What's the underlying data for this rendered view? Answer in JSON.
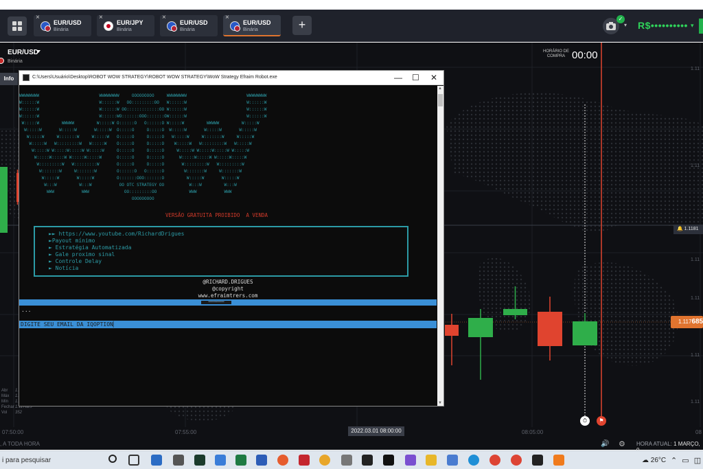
{
  "topbar": {
    "tabs": [
      {
        "pair": "EUR/USD",
        "kind": "Binária",
        "flag": "eu-us-flag-icon"
      },
      {
        "pair": "EUR/JPY",
        "kind": "Binária",
        "flag": "eu-jp-flag-icon"
      },
      {
        "pair": "EUR/USD",
        "kind": "Binária",
        "flag": "eu-us-flag-icon"
      },
      {
        "pair": "EUR/USD",
        "kind": "Binária",
        "flag": "eu-us-flag-icon",
        "active": true
      }
    ],
    "add_tab": "+",
    "balance": "R$••••••••••",
    "icons": [
      "apps-grid-icon",
      "camera-icon",
      "check-icon",
      "chevron-down-icon"
    ]
  },
  "chart": {
    "asset": "EUR/USD",
    "asset_type": "Binária",
    "info_button": "Info",
    "timer_label_line1": "HORÁRIO DE",
    "timer_label_line2": "COMPRA",
    "timer_value": "00:00",
    "current_price_prefix": "1.117",
    "current_price_suffix": "685",
    "alert_price": "1.1181",
    "y_labels": [
      "1.11",
      "1.11",
      "1.11",
      "1.11",
      "1.11",
      "1.11"
    ],
    "x_labels": [
      "07:50:00",
      "07:55:00",
      "08:05:00",
      "08"
    ],
    "x_active_label": "2022.03.01 08:00:00",
    "ohlc": [
      {
        "k": "Abr",
        "v": "1."
      },
      {
        "k": "Máx",
        "v": "1."
      },
      {
        "k": "Mín",
        "v": "1."
      },
      {
        "k": "Fechar",
        "v": "1.117825"
      },
      {
        "k": "Vol",
        "v": "352"
      }
    ],
    "colors": {
      "up": "#2fae4a",
      "down": "#e0442f",
      "accent": "#e0742f",
      "background": "#0f1014"
    }
  },
  "bottombar": {
    "left_text": "A TODA HORA",
    "time_label": "HORA ATUAL:",
    "time_value": "1 MARÇO, 0"
  },
  "console": {
    "title": "C:\\Users\\Usuário\\Desktop\\ROBOT WOW STRATEGY\\ROBOT WOW STRATEGY\\WoW Strategy Efraim Robot.exe",
    "ascii_lines": [
      "",
      "WWWWWWWW                        WWWWWWWW     OOOOOOOOO     WWWWWWWW                        WWWWWWWW",
      "W::::::W                        W::::::W   OO:::::::::OO   W::::::W                        W::::::W",
      "W::::::W                        W::::::W OO:::::::::::::OO W::::::W                        W::::::W",
      "W::::::W                        W::::::WO:::::::OOO:::::::OW::::::W                        W::::::W",
      " W:::::W         WWWWW         W:::::W O::::::O   O::::::O W:::::W         WWWWW         W:::::W",
      "  W:::::W       W:::::W       W:::::W  O:::::O     O:::::O  W:::::W       W:::::W       W:::::W",
      "   W:::::W     W:::::::W     W:::::W   O:::::O     O:::::O   W:::::W     W:::::::W     W:::::W",
      "    W:::::W   W:::::::::W   W:::::W    O:::::O     O:::::O    W:::::W   W:::::::::W   W:::::W",
      "     W:::::W W:::::W:::::W W:::::W     O:::::O     O:::::O     W:::::W W:::::W:::::W W:::::W",
      "      W:::::W:::::W W:::::W:::::W      O:::::O     O:::::O      W:::::W:::::W W:::::W:::::W",
      "       W:::::::::W   W:::::::::W       O:::::O     O:::::O       W:::::::::W   W:::::::::W",
      "        W:::::::W     W:::::::W        O::::::O   O::::::O        W:::::::W     W:::::::W",
      "         W:::::W       W:::::W         O:::::::OOO:::::::O         W:::::W       W:::::W",
      "          W:::W         W:::W           OO OTC STRATEGY OO          W:::W         W:::W",
      "           WWW           WWW              OO:::::::::OO             WWW           WWW",
      "                                             OOOOOOOOO"
    ],
    "version_warning": "VERSÃO GRATUITA PROIBIDO  A VENDA",
    "menu_items": [
      "►► https://www.youtube.com/RichardDrigues",
      "►Payout mínimo",
      "► Estratégia Automatizada",
      "► Gale proximo sinal",
      "► Controle Delay",
      "► Notícia"
    ],
    "credit_lines": [
      "@RICHARD.DRIGUES",
      "@copyright",
      "www.efraimtrers.com"
    ],
    "separator_mid": "═══•═══",
    "dots": "...",
    "email_prompt": "DIGITE SEU EMAIL DA IQOPTION"
  },
  "taskbar": {
    "search_placeholder": "i para pesquisar",
    "weather": "26°C"
  }
}
